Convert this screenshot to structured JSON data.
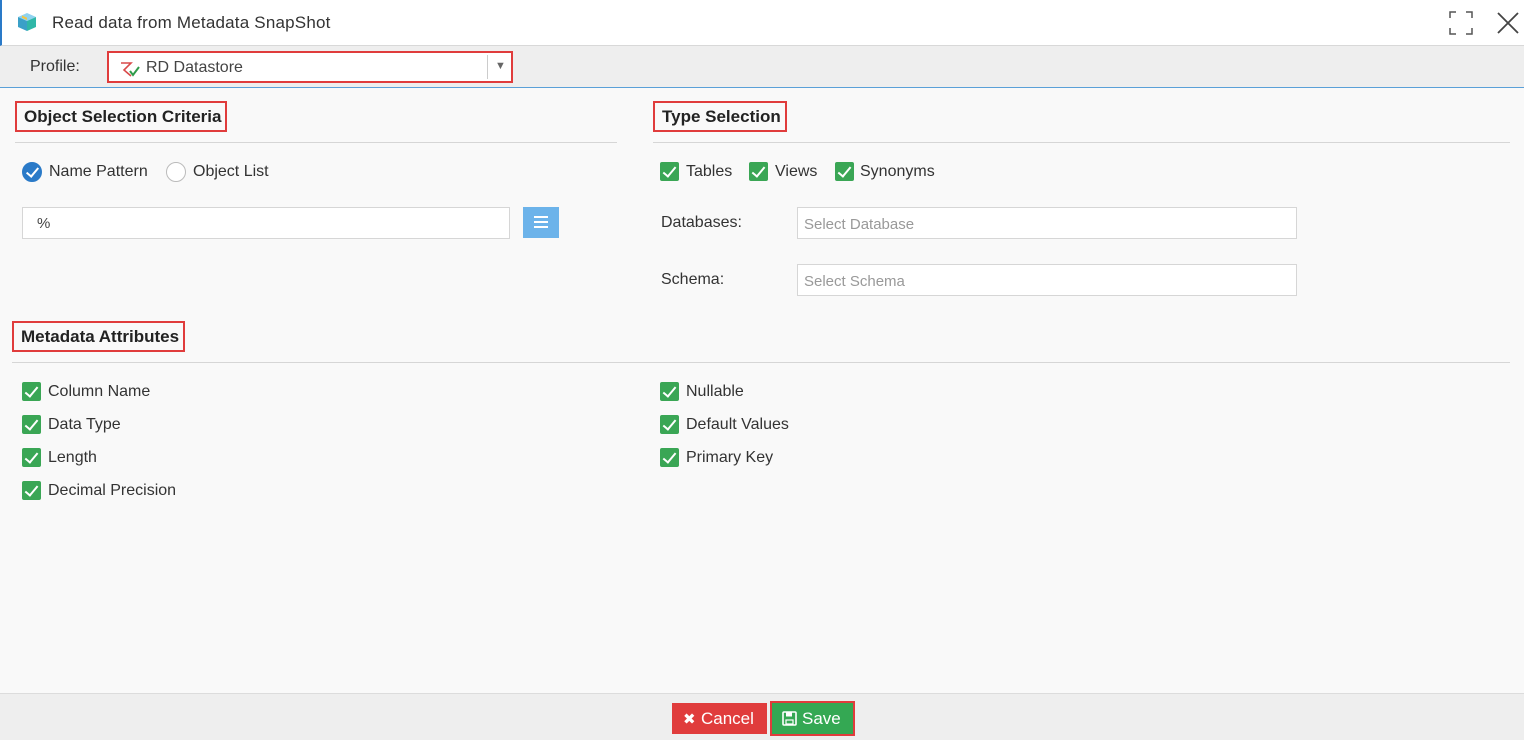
{
  "window": {
    "title": "Read data from Metadata SnapShot"
  },
  "profile": {
    "label": "Profile:",
    "value": "RD Datastore"
  },
  "object_selection": {
    "title": "Object Selection Criteria",
    "options": [
      {
        "label": "Name Pattern",
        "checked": true
      },
      {
        "label": "Object List",
        "checked": false
      }
    ],
    "pattern_value": "%"
  },
  "type_selection": {
    "title": "Type Selection",
    "types": [
      {
        "label": "Tables",
        "checked": true
      },
      {
        "label": "Views",
        "checked": true
      },
      {
        "label": "Synonyms",
        "checked": true
      }
    ],
    "databases_label": "Databases:",
    "databases_placeholder": "Select Database",
    "schema_label": "Schema:",
    "schema_placeholder": "Select Schema"
  },
  "metadata_attributes": {
    "title": "Metadata Attributes",
    "left": [
      {
        "label": "Column Name",
        "checked": true
      },
      {
        "label": "Data Type",
        "checked": true
      },
      {
        "label": "Length",
        "checked": true
      },
      {
        "label": "Decimal Precision",
        "checked": true
      }
    ],
    "right": [
      {
        "label": "Nullable",
        "checked": true
      },
      {
        "label": "Default Values",
        "checked": true
      },
      {
        "label": "Primary Key",
        "checked": true
      }
    ]
  },
  "footer": {
    "cancel_label": "Cancel",
    "save_label": "Save"
  },
  "colors": {
    "accent_blue": "#2a7ac8",
    "check_green": "#3aa655",
    "cancel_red": "#e03c3c",
    "save_green": "#34a853",
    "highlight_red": "#e03c3c"
  }
}
